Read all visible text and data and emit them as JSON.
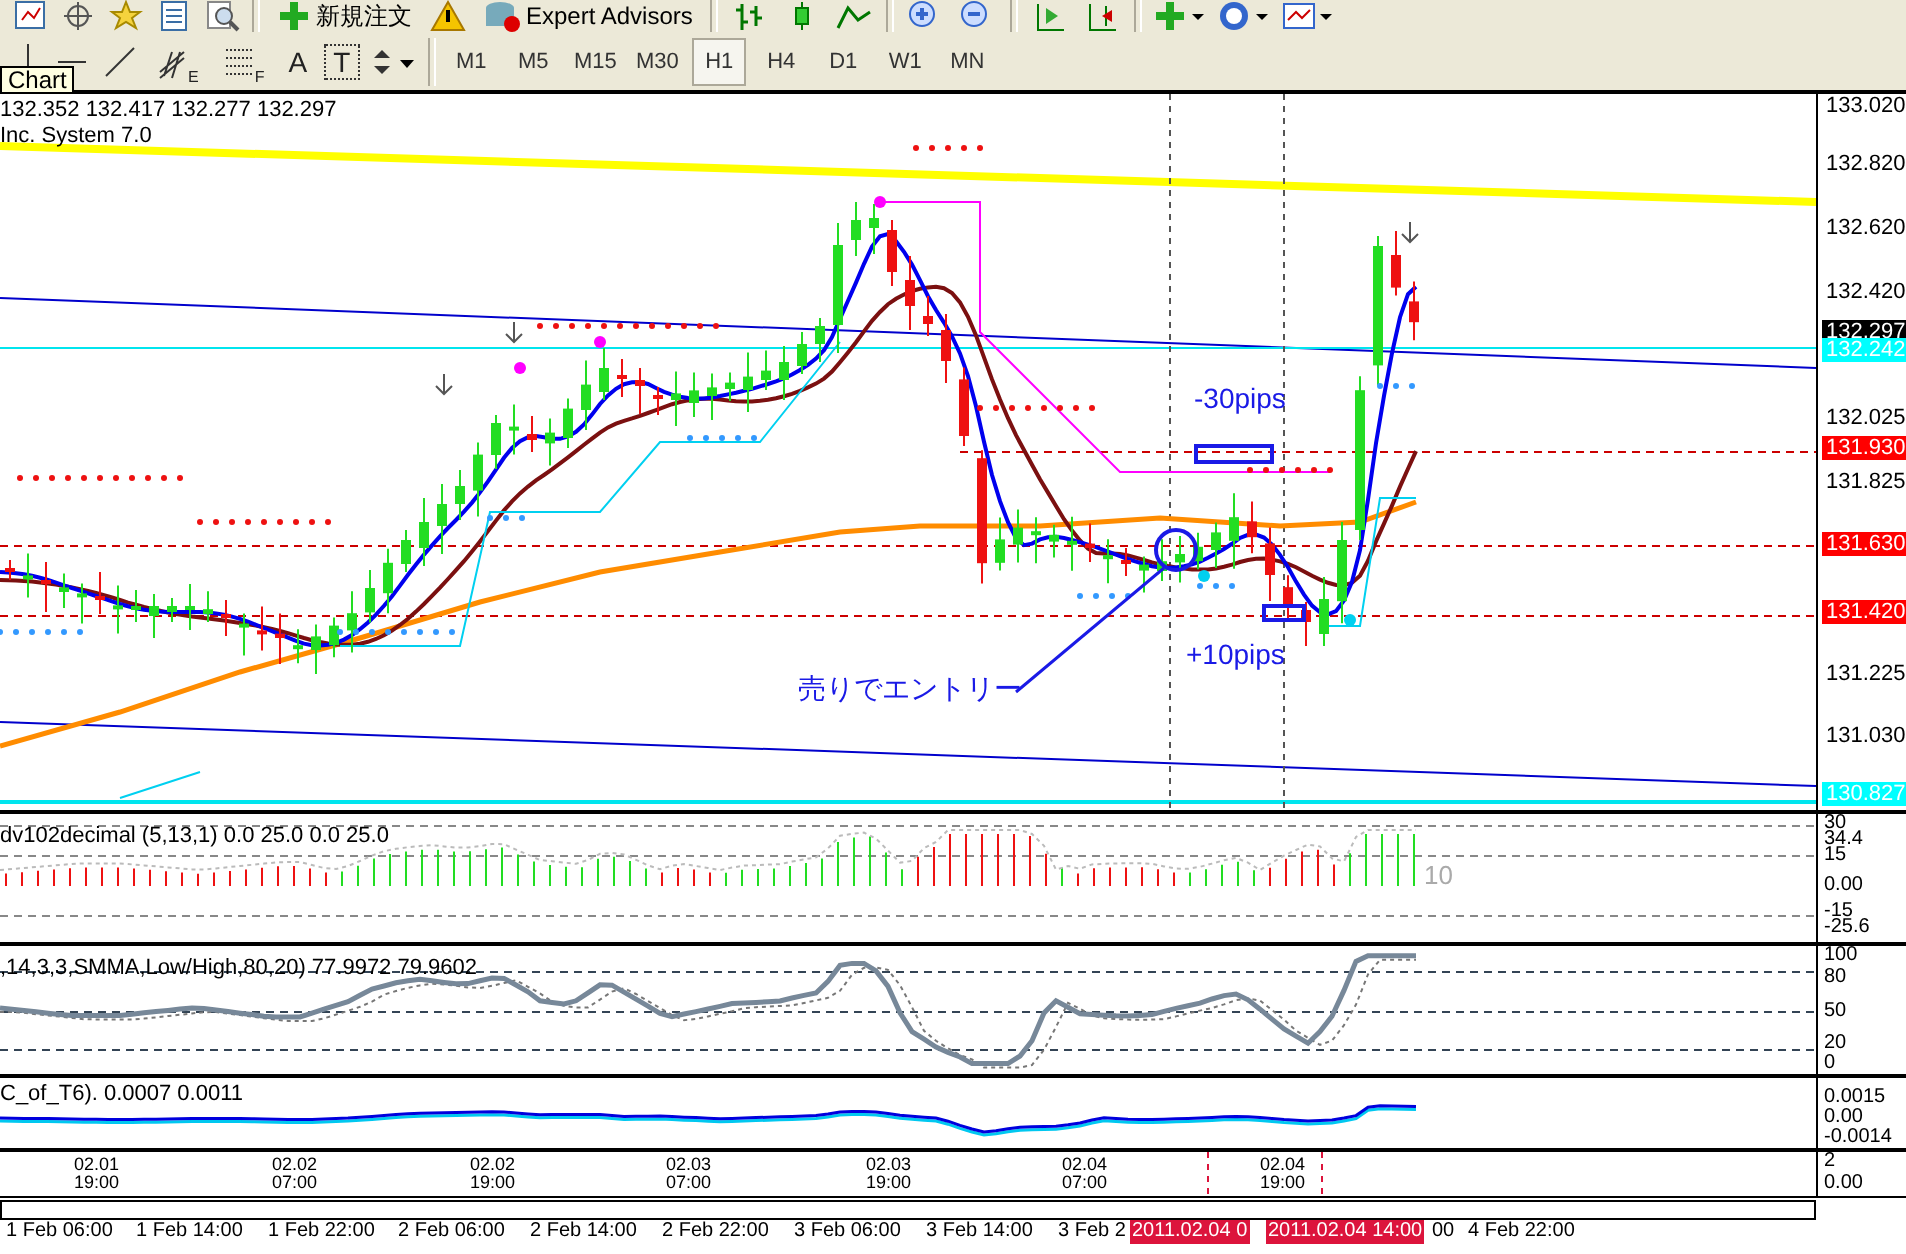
{
  "toolbar": {
    "new_order": "新規注文",
    "expert_advisors": "Expert Advisors"
  },
  "drawing_tools": {
    "channel_mark": "E",
    "fibo_mark": "F",
    "text_tool": "A",
    "label_tool": "T"
  },
  "timeframes": [
    {
      "label": "M1",
      "selected": false
    },
    {
      "label": "M5",
      "selected": false
    },
    {
      "label": "M15",
      "selected": false
    },
    {
      "label": "M30",
      "selected": false
    },
    {
      "label": "H1",
      "selected": true
    },
    {
      "label": "H4",
      "selected": false
    },
    {
      "label": "D1",
      "selected": false
    },
    {
      "label": "W1",
      "selected": false
    },
    {
      "label": "MN",
      "selected": false
    }
  ],
  "tooltip": "Chart",
  "main_chart": {
    "header": [
      "132.352 132.417 132.277 132.297",
      "Inc. System 7.0"
    ],
    "price_labels": [
      {
        "text": "133.020",
        "kind": "tick"
      },
      {
        "text": "132.820",
        "kind": "tick"
      },
      {
        "text": "132.620",
        "kind": "tick"
      },
      {
        "text": "132.420",
        "kind": "tick"
      },
      {
        "text": "132.297",
        "kind": "bid"
      },
      {
        "text": "132.242",
        "kind": "line"
      },
      {
        "text": "132.025",
        "kind": "tick"
      },
      {
        "text": "131.930",
        "kind": "level"
      },
      {
        "text": "131.825",
        "kind": "tick"
      },
      {
        "text": "131.630",
        "kind": "level"
      },
      {
        "text": "131.420",
        "kind": "level"
      },
      {
        "text": "131.225",
        "kind": "tick"
      },
      {
        "text": "131.030",
        "kind": "tick"
      },
      {
        "text": "130.827",
        "kind": "line"
      }
    ],
    "annotations": [
      "-30pips",
      "+10pips",
      "売りでエントリー"
    ]
  },
  "indicators": [
    {
      "kind": "histogram",
      "header": "dv102decimal (5,13,1) 0.0 25.0 0.0 25.0",
      "value_label": "10",
      "scale": [
        "30",
        "34.4",
        "15",
        "0.00",
        "-15",
        "-25.6"
      ]
    },
    {
      "kind": "stochastic",
      "header": ",14,3,3,SMMA,Low/High,80,20) 77.9972 79.9602",
      "scale": [
        "100",
        "80",
        "50",
        "20",
        "0"
      ]
    },
    {
      "kind": "lines",
      "header": "C_of_T6). 0.0007 0.0011",
      "scale": [
        "0.0015",
        "0.00",
        "-0.0014"
      ]
    }
  ],
  "date_panel": {
    "scale": [
      "2",
      "0.00"
    ],
    "dates": [
      {
        "date": "02.01",
        "time": "19:00"
      },
      {
        "date": "02.02",
        "time": "07:00"
      },
      {
        "date": "02.02",
        "time": "19:00"
      },
      {
        "date": "02.03",
        "time": "07:00"
      },
      {
        "date": "02.03",
        "time": "19:00"
      },
      {
        "date": "02.04",
        "time": "07:00"
      },
      {
        "date": "02.04",
        "time": "19:00"
      }
    ]
  },
  "time_axis": [
    {
      "text": "1 Feb 06:00",
      "kind": "tick"
    },
    {
      "text": "1 Feb 14:00",
      "kind": "tick"
    },
    {
      "text": "1 Feb 22:00",
      "kind": "tick"
    },
    {
      "text": "2 Feb 06:00",
      "kind": "tick"
    },
    {
      "text": "2 Feb 14:00",
      "kind": "tick"
    },
    {
      "text": "2 Feb 22:00",
      "kind": "tick"
    },
    {
      "text": "3 Feb 06:00",
      "kind": "tick"
    },
    {
      "text": "3 Feb 14:00",
      "kind": "tick"
    },
    {
      "text": "3 Feb 2",
      "kind": "tick"
    },
    {
      "text": "2011.02.04 0",
      "kind": "cursor"
    },
    {
      "text": "2011.02.04 14:00",
      "kind": "cursor"
    },
    {
      "text": "00",
      "kind": "tick"
    },
    {
      "text": "4 Feb 22:00",
      "kind": "tick"
    }
  ]
}
